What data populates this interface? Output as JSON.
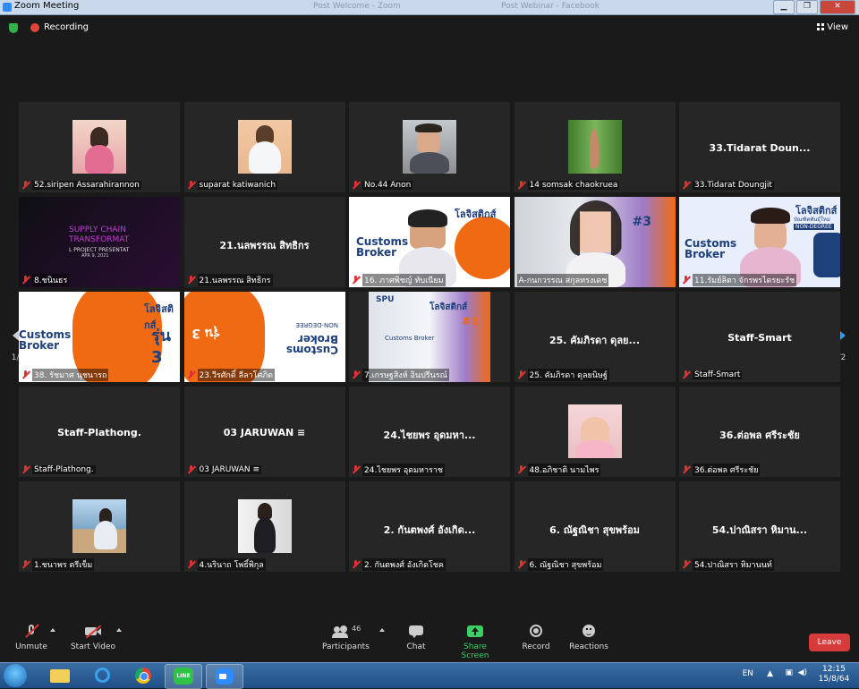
{
  "window": {
    "title": "Zoom Meeting",
    "ghost_tabs": [
      "Post Welcome - Zoom",
      "Post Webinar - Facebook"
    ]
  },
  "status": {
    "recording": "Recording",
    "view": "View"
  },
  "tiles": [
    {
      "name": "52.siripen Assarahirannon",
      "type": "photo",
      "big": ""
    },
    {
      "name": "suparat katiwanich",
      "type": "photo",
      "big": ""
    },
    {
      "name": "No.44 Anon",
      "type": "photo",
      "big": ""
    },
    {
      "name": "14 somsak chaokruea",
      "type": "photo",
      "big": ""
    },
    {
      "name": "33.Tidarat Doungjit",
      "type": "text",
      "big": "33.Tidarat Doun..."
    },
    {
      "name": "8.ชนินธร",
      "type": "slide-supply",
      "big": "SUPPLY CHAIN TRANSFORMAT"
    },
    {
      "name": "21.นลพรรณ สิทธิกร",
      "type": "text",
      "big": "21.นลพรรณ สิทธิกร"
    },
    {
      "name": "16. ภาศพิชญ์ ทับเนียม",
      "type": "slide-customs",
      "big": ""
    },
    {
      "name": "A-กนกวรรณ สกุลทรงเดช",
      "type": "video-active",
      "big": ""
    },
    {
      "name": "11.รัมย์ลิตา จักรพรไตรยะรัช",
      "type": "slide-customs",
      "big": ""
    },
    {
      "name": "38. รัชมาศ นุชนารถ",
      "type": "slide-customs",
      "big": ""
    },
    {
      "name": "23.วีรศักดิ์ ลีลาโศภิต",
      "type": "slide-flip",
      "big": ""
    },
    {
      "name": "7.เกรษฐสิงห์ อินปรีนรณ์",
      "type": "slide-building",
      "big": ""
    },
    {
      "name": "25. คัมภิรดา ดุลยนิษฐ์",
      "type": "text",
      "big": "25. คัมภิรดา ดุลย..."
    },
    {
      "name": "Staff-Smart",
      "type": "text",
      "big": "Staff-Smart"
    },
    {
      "name": "Staff-Plathong.",
      "type": "text",
      "big": "Staff-Plathong."
    },
    {
      "name": "03 JARUWAN ≡",
      "type": "text",
      "big": "03 JARUWAN ≡"
    },
    {
      "name": "24.ไชยพร อุดมหาราช",
      "type": "text",
      "big": "24.ไชยพร อุดมหา..."
    },
    {
      "name": "48.อภิชาติ นามไพร",
      "type": "photo",
      "big": ""
    },
    {
      "name": "36.ต่อพล ศรีระชัย",
      "type": "text",
      "big": "36.ต่อพล ศรีระชัย"
    },
    {
      "name": "1.ชนาพร ตรีเข็ม",
      "type": "photo",
      "big": ""
    },
    {
      "name": "4.นรินาถ โพธิ์พิกุล",
      "type": "photo",
      "big": ""
    },
    {
      "name": "2. กันตพงศ์ อังเกิดโชค",
      "type": "text",
      "big": "2. กันตพงศ์ อังเกิด..."
    },
    {
      "name": "6. ณัฐณิชา สุขพร้อม",
      "type": "text",
      "big": "6. ณัฐณิชา สุขพร้อม"
    },
    {
      "name": "54.ปาณิสรา หิมานนท์",
      "type": "text",
      "big": "54.ปาณิสรา หิมาน..."
    }
  ],
  "slides": {
    "customs_title": "โลจิสติกส์",
    "customs_sub": "บัณฑิตพันธุ์ใหม่",
    "customs_badge": "NON-DEGREE",
    "customs_broker": "Customs Broker",
    "round": "รุ่น 3",
    "supply_line1": "SUPPLY CHAIN",
    "supply_line2": "TRANSFORMAT",
    "supply_line3": "L PROJECT PRESENTAT",
    "supply_date": "APR 9, 2021",
    "spu": "SPU",
    "tag3": "#3"
  },
  "pager": {
    "left": "1/2",
    "right": "1/2"
  },
  "toolbar": {
    "unmute": "Unmute",
    "start_video": "Start Video",
    "participants": "Participants",
    "participants_count": "46",
    "chat": "Chat",
    "share": "Share Screen",
    "record": "Record",
    "reactions": "Reactions",
    "leave": "Leave"
  },
  "taskbar": {
    "lang": "EN",
    "time": "12:15",
    "date": "15/8/64",
    "line_app": "LINE"
  },
  "colors": {
    "accent_yellow": "#e7e21c",
    "share_green": "#3ccf63",
    "leave_red": "#d63a3a",
    "mute_red": "#dd3333"
  }
}
